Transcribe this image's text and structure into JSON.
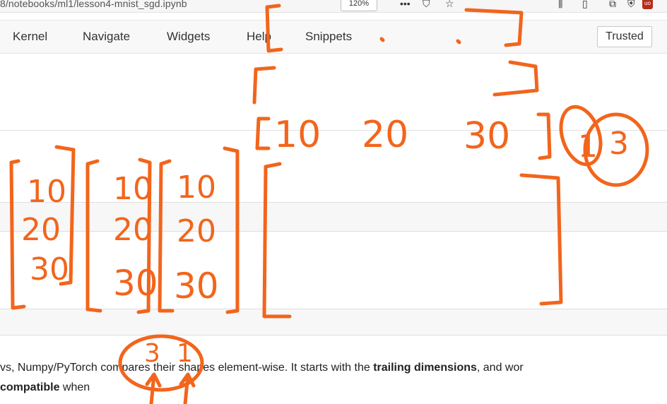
{
  "browser": {
    "url": "8/notebooks/ml1/lesson4-mnist_sgd.ipynb",
    "zoom": "120%",
    "icons": [
      "more-icon",
      "bookmark-shield-icon",
      "star-icon",
      "library-icon",
      "sidebar-icon",
      "extension-icon",
      "shield-icon",
      "ublock-icon"
    ],
    "ublock_label": "uo"
  },
  "menu": {
    "items": [
      "Kernel",
      "Navigate",
      "Widgets",
      "Help",
      "Snippets"
    ],
    "trusted": "Trusted"
  },
  "annotation": {
    "row": [
      "10",
      "20",
      "30"
    ],
    "row_shape": [
      "1",
      "3"
    ],
    "col1": [
      "10",
      "20",
      "30"
    ],
    "col2": [
      "10",
      "20",
      "30"
    ],
    "col3": [
      "10",
      "20",
      "30"
    ],
    "col_shape": [
      "3",
      "1"
    ],
    "ink_color": "#f2651c"
  },
  "markdown": {
    "line1_a": "vs, Numpy/PyTorch compares their shapes element-wise. It starts with the ",
    "line1_bold": "trailing dimensions",
    "line1_b": ", and wor",
    "line2_bold": "compatible",
    "line2_a": " when"
  }
}
